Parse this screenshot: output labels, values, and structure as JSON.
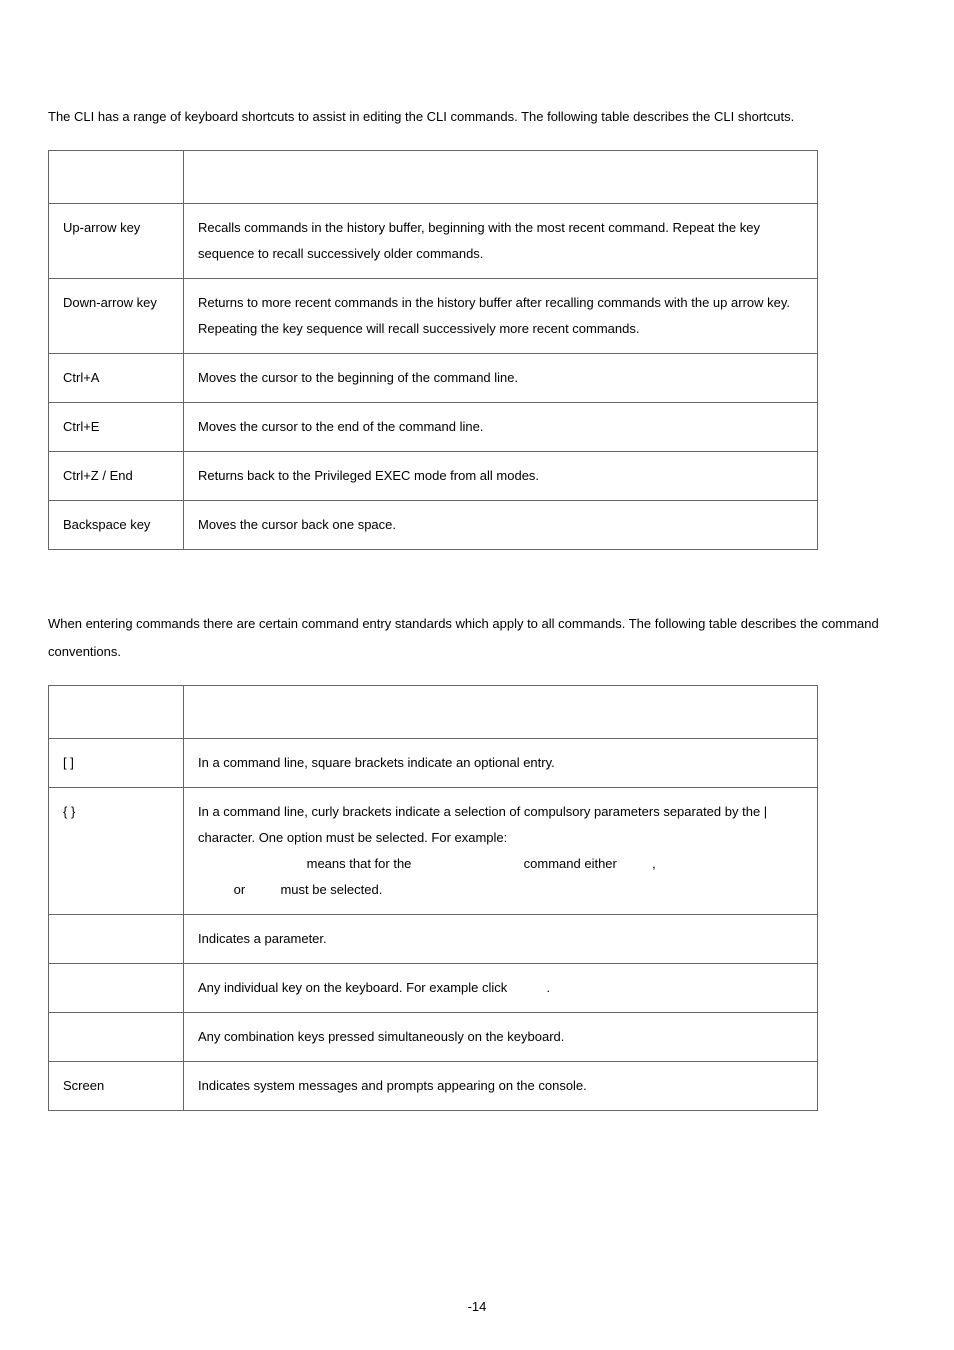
{
  "intro1": "The CLI has a range of keyboard shortcuts to assist in editing the CLI commands. The following table describes the CLI shortcuts.",
  "table1": {
    "head_col1": "",
    "head_col2": "",
    "rows": [
      {
        "k": "Up-arrow key",
        "d": "Recalls commands in the history buffer, beginning with the most recent command. Repeat the key sequence to recall successively older commands."
      },
      {
        "k": "Down-arrow key",
        "d": "Returns to more recent commands in the history buffer after recalling commands with the up arrow key. Repeating the key sequence will recall successively more recent commands."
      },
      {
        "k": "Ctrl+A",
        "d": "Moves the cursor to the beginning of the command line."
      },
      {
        "k": "Ctrl+E",
        "d": "Moves the cursor to the end of the command line."
      },
      {
        "k": "Ctrl+Z / End",
        "d": "Returns back to the Privileged EXEC mode from all modes."
      },
      {
        "k": "Backspace key",
        "d": "Moves the cursor back one space."
      }
    ]
  },
  "intro2": "When entering commands there are certain command entry standards which apply to all commands. The following table describes the command conventions.",
  "table2": {
    "head_col1": "",
    "head_col2": "",
    "rows": {
      "r1k": "[ ]",
      "r1d": "In a command line, square brackets indicate an optional entry.",
      "r2k": "{ }",
      "r2d_line1": "In a command line, curly brackets indicate a selection of compulsory parameters separated by the | character. One option must be selected. For example:",
      "r2d_means": "means that for the",
      "r2d_cmd": "command either",
      "r2d_comma": ",",
      "r2d_or": "or",
      "r2d_must": "must be selected.",
      "r3k": "",
      "r3d": "Indicates a parameter.",
      "r4k": "",
      "r4d": "Any individual key on the keyboard. For example click",
      "r4d_dot": ".",
      "r5k": "",
      "r5d": "Any combination keys pressed simultaneously on the keyboard.",
      "r6k": "Screen",
      "r6d": "Indicates system messages and prompts appearing on the console."
    }
  },
  "footer": "-14"
}
